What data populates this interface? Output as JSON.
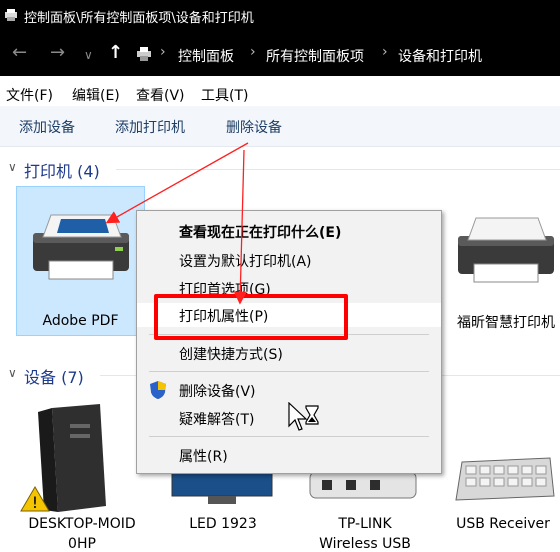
{
  "window": {
    "title": "控制面板\\所有控制面板项\\设备和打印机"
  },
  "address": {
    "crumbs": [
      "控制面板",
      "所有控制面板项",
      "设备和打印机"
    ]
  },
  "menubar": {
    "items": [
      "文件(F)",
      "编辑(E)",
      "查看(V)",
      "工具(T)"
    ]
  },
  "commands": {
    "add_device": "添加设备",
    "add_printer": "添加打印机",
    "remove_device": "删除设备"
  },
  "groups": {
    "printers": "打印机 (4)",
    "devices": "设备 (7)"
  },
  "printers": [
    {
      "label": "Adobe PDF",
      "selected": true
    },
    {
      "label": "福昕智慧打印机",
      "selected": false
    }
  ],
  "devices": [
    {
      "label": "DESKTOP-MOID",
      "label2": "0HP",
      "icon": "computer-icon"
    },
    {
      "label": "LED 1923",
      "icon": "monitor-icon"
    },
    {
      "label": "TP-LINK",
      "label2": "Wireless USB",
      "icon": "usb-adapter-icon"
    },
    {
      "label": "USB Receiver",
      "icon": "keyboard-icon"
    }
  ],
  "context_menu": {
    "see_printing": "查看现在正在打印什么(E)",
    "set_default": "设置为默认打印机(A)",
    "preferences": "打印首选项(G)",
    "printer_properties": "打印机属性(P)",
    "create_shortcut": "创建快捷方式(S)",
    "remove_device": "删除设备(V)",
    "troubleshoot": "疑难解答(T)",
    "properties": "属性(R)"
  },
  "colors": {
    "selection": "#cce8ff",
    "highlight_box": "#ff0000",
    "group_header": "#1e3a8a"
  }
}
